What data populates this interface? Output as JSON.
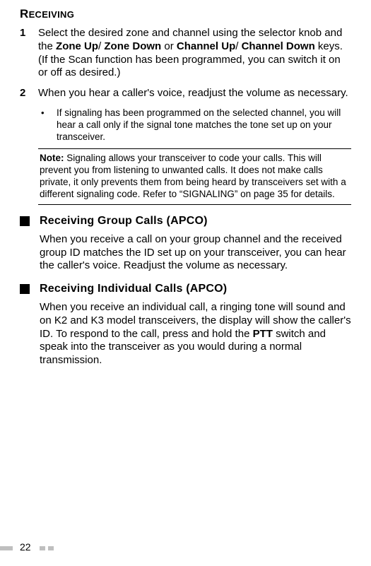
{
  "title_main": "R",
  "title_rest": "ECEIVING",
  "steps": [
    {
      "num": "1",
      "body_html": "Select the desired zone and channel using the selector knob and the <b>Zone Up</b>/  <b>Zone Down</b> or <b>Channel Up</b>/ <b>Channel Down</b> keys.  (If the Scan function has been programmed, you can switch it on or off as desired.)"
    },
    {
      "num": "2",
      "body_html": "When you hear a caller's voice, readjust the volume as necessary."
    }
  ],
  "bullet_text": "If signaling has been programmed on the selected channel, you will hear a call only if the signal tone matches the tone set up on your transceiver.",
  "note_html": "<b>Note:</b>  Signaling allows your transceiver to code your calls.  This will prevent you from listening to unwanted calls.  It does not make calls private, it only prevents them from being heard by transceivers set with a different signaling code.  Refer to “SIGNALING” on page 35 for details.",
  "sections": [
    {
      "heading": "Receiving Group Calls (APCO)",
      "body_html": "When you receive a call on your group channel and the received group ID matches the ID set up on your transceiver, you can hear the caller's voice.  Readjust the volume as necessary."
    },
    {
      "heading": "Receiving Individual Calls (APCO)",
      "body_html": "When you receive an individual call, a ringing tone will sound and on K2 and K3 model transceivers, the display will show the caller's ID.  To respond to the call, press and hold the <b>PTT</b> switch and speak into the transceiver as you would during a normal transmission."
    }
  ],
  "page_number": "22"
}
